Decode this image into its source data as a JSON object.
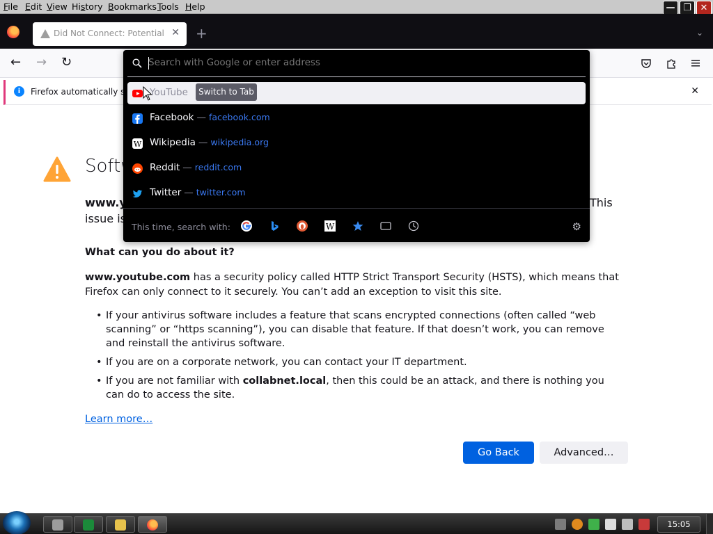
{
  "menu": [
    "File",
    "Edit",
    "View",
    "History",
    "Bookmarks",
    "Tools",
    "Help"
  ],
  "menu_accel": [
    "F",
    "E",
    "V",
    "s",
    "B",
    "T",
    "H"
  ],
  "window_buttons": {
    "minimize": "—",
    "restore": "❐",
    "close": "✕"
  },
  "tab": {
    "title": "Did Not Connect: Potential Se",
    "close": "✕"
  },
  "newtab_label": "+",
  "tablist_label": "⌄",
  "nav": {
    "back": "←",
    "forward": "→",
    "reload": "↻"
  },
  "toolbar_icons": [
    "pocket-icon",
    "extensions-icon",
    "menu-icon"
  ],
  "notification": {
    "text": "Firefox automatically sen",
    "close": "✕"
  },
  "urlbar": {
    "placeholder": "Search with Google or enter address",
    "suggestions": [
      {
        "name": "YouTube",
        "url": "",
        "color": "#ff0000",
        "selected": true,
        "action": "Switch to Tab"
      },
      {
        "name": "Facebook",
        "url": "facebook.com",
        "color": "#1877f2"
      },
      {
        "name": "Wikipedia",
        "url": "wikipedia.org",
        "color": "#ffffff"
      },
      {
        "name": "Reddit",
        "url": "reddit.com",
        "color": "#ff4500"
      },
      {
        "name": "Twitter",
        "url": "twitter.com",
        "color": "#1da1f2"
      }
    ],
    "one_off_label": "This time, search with:",
    "engines": [
      "google-icon",
      "bing-icon",
      "duckduckgo-icon",
      "wikipedia-icon",
      "bookmarks-icon",
      "tabs-icon",
      "history-icon"
    ]
  },
  "page": {
    "title_visible": "Softw",
    "desc_start": "www.yo",
    "desc_end": "This",
    "desc_line2": "issue is",
    "what_heading": "What can you do about it?",
    "hsts_host": "www.youtube.com",
    "hsts_text": " has a security policy called HTTP Strict Transport Security (HSTS), which means that Firefox can only connect to it securely. You can’t add an exception to visit this site.",
    "tips": [
      "If your antivirus software includes a feature that scans encrypted connections (often called “web scanning” or “https scanning”), you can disable that feature. If that doesn’t work, you can remove and reinstall the antivirus software.",
      "If you are on a corporate network, you can contact your IT department."
    ],
    "tip3_a": "If you are not familiar with ",
    "tip3_host": "collabnet.local",
    "tip3_b": ", then this could be an attack, and there is nothing you can do to access the site.",
    "learn_more": "Learn more…",
    "go_back": "Go Back",
    "advanced": "Advanced…"
  },
  "taskbar": {
    "clock": "15:05"
  },
  "colors": {
    "accent": "#0061e0",
    "warning": "#ffa436",
    "notification_border": "#e0387b"
  }
}
